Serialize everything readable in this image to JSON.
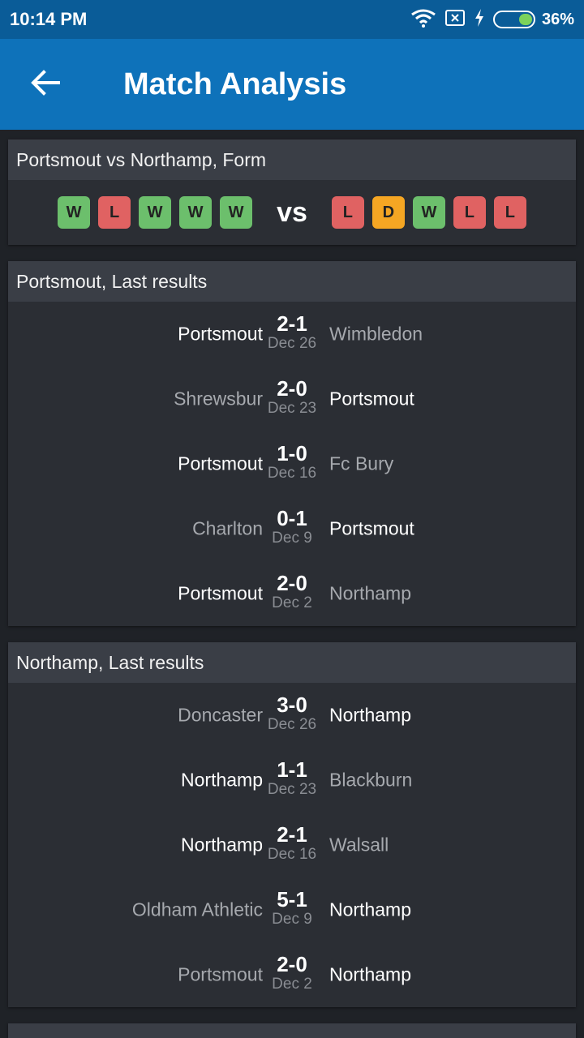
{
  "status_bar": {
    "time": "10:14 PM",
    "battery_percent": "36%",
    "battery_level": 0.36,
    "icons": [
      "wifi-icon",
      "no-sim-icon",
      "charging-icon",
      "battery-icon"
    ]
  },
  "app_bar": {
    "title": "Match Analysis",
    "back_icon": "arrow-left-icon"
  },
  "form_card": {
    "header": "Portsmout vs Northamp, Form",
    "home_form": [
      "W",
      "L",
      "W",
      "W",
      "W"
    ],
    "vs_label": "vs",
    "away_form": [
      "L",
      "D",
      "W",
      "L",
      "L"
    ]
  },
  "home_results": {
    "header": "Portsmout, Last results",
    "rows": [
      {
        "home": "Portsmout",
        "score": "2-1",
        "date": "Dec 26",
        "away": "Wimbledon",
        "home_emph": true
      },
      {
        "home": "Shrewsbur",
        "score": "2-0",
        "date": "Dec 23",
        "away": "Portsmout",
        "home_emph": false
      },
      {
        "home": "Portsmout",
        "score": "1-0",
        "date": "Dec 16",
        "away": "Fc Bury",
        "home_emph": true
      },
      {
        "home": "Charlton",
        "score": "0-1",
        "date": "Dec 9",
        "away": "Portsmout",
        "home_emph": false
      },
      {
        "home": "Portsmout",
        "score": "2-0",
        "date": "Dec 2",
        "away": "Northamp",
        "home_emph": true
      }
    ]
  },
  "away_results": {
    "header": "Northamp, Last results",
    "rows": [
      {
        "home": "Doncaster",
        "score": "3-0",
        "date": "Dec 26",
        "away": "Northamp",
        "home_emph": false
      },
      {
        "home": "Northamp",
        "score": "1-1",
        "date": "Dec 23",
        "away": "Blackburn",
        "home_emph": true
      },
      {
        "home": "Northamp",
        "score": "2-1",
        "date": "Dec 16",
        "away": "Walsall",
        "home_emph": true
      },
      {
        "home": "Oldham Athletic",
        "score": "5-1",
        "date": "Dec 9",
        "away": "Northamp",
        "home_emph": false
      },
      {
        "home": "Portsmout",
        "score": "2-0",
        "date": "Dec 2",
        "away": "Northamp",
        "home_emph": false
      }
    ]
  },
  "colors": {
    "status_bar": "#0a5c98",
    "app_bar": "#0e72ba",
    "win": "#6cbf6c",
    "loss": "#e06262",
    "draw": "#f5a623"
  }
}
